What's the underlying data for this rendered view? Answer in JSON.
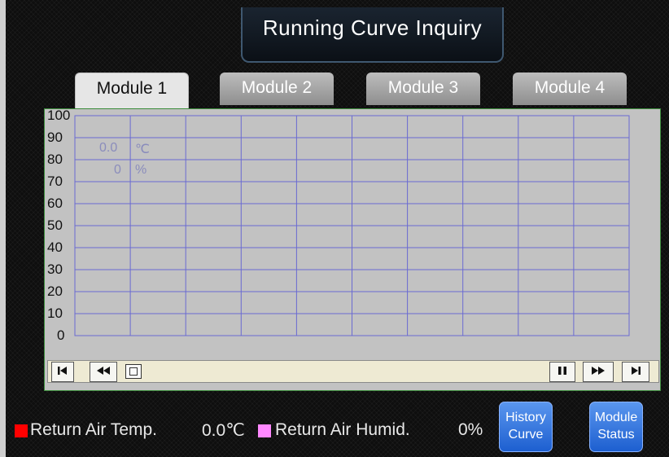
{
  "header": {
    "title": "Running Curve Inquiry"
  },
  "tabs": [
    {
      "label": "Module 1",
      "active": true
    },
    {
      "label": "Module 2",
      "active": false
    },
    {
      "label": "Module 3",
      "active": false
    },
    {
      "label": "Module 4",
      "active": false
    }
  ],
  "chart_data": {
    "type": "line",
    "yticks": [
      "100",
      "90",
      "80",
      "70",
      "60",
      "50",
      "40",
      "30",
      "20",
      "10",
      "0"
    ],
    "ylim": [
      0,
      100
    ],
    "grid": true,
    "vertical_gridlines": 10,
    "series": [],
    "readouts": [
      {
        "value": "0.0",
        "unit": "℃"
      },
      {
        "value": "0",
        "unit": "%"
      }
    ]
  },
  "scrollbar": {
    "first_icon": "skip-to-start-icon",
    "rewind_icon": "rewind-icon",
    "pause_icon": "pause-icon",
    "forward_icon": "fast-forward-icon",
    "last_icon": "skip-to-end-icon"
  },
  "legend": [
    {
      "label": "Return Air Temp.",
      "value": "0.0℃",
      "color": "#ff0000"
    },
    {
      "label": "Return Air Humid.",
      "value": "0%",
      "color": "#ff88ff"
    }
  ],
  "buttons": {
    "history_curve": [
      "History",
      "Curve"
    ],
    "module_status": [
      "Module",
      "Status"
    ]
  },
  "colors": {
    "grid": "#6a6ad2",
    "button_blue": "#2a6fe0"
  }
}
